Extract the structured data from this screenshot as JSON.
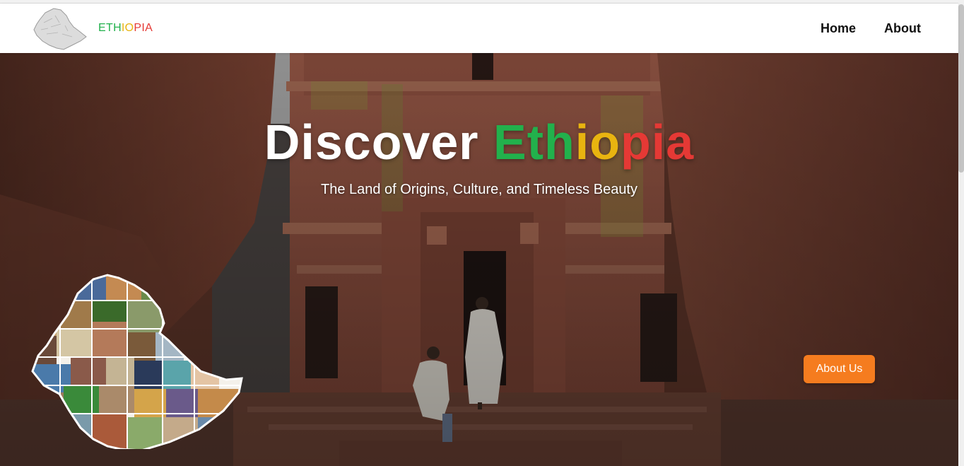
{
  "navbar": {
    "brand_letters": [
      {
        "ch": "E",
        "color": "#22b14c"
      },
      {
        "ch": "T",
        "color": "#22b14c"
      },
      {
        "ch": "H",
        "color": "#22b14c"
      },
      {
        "ch": "I",
        "color": "#e8b410"
      },
      {
        "ch": "O",
        "color": "#e8b410"
      },
      {
        "ch": "P",
        "color": "#e53935"
      },
      {
        "ch": "I",
        "color": "#e53935"
      },
      {
        "ch": "A",
        "color": "#e53935"
      }
    ],
    "links": {
      "home": "Home",
      "about": "About"
    }
  },
  "hero": {
    "title_word": "Discover",
    "title_letters": [
      {
        "ch": "E",
        "color": "#22b14c"
      },
      {
        "ch": "t",
        "color": "#22b14c"
      },
      {
        "ch": "h",
        "color": "#22b14c"
      },
      {
        "ch": "i",
        "color": "#e8b410"
      },
      {
        "ch": "o",
        "color": "#e8b410"
      },
      {
        "ch": "p",
        "color": "#e53935"
      },
      {
        "ch": "i",
        "color": "#e53935"
      },
      {
        "ch": "a",
        "color": "#e53935"
      }
    ],
    "subtitle": "The Land of Origins, Culture, and Timeless Beauty",
    "cta_label": "About Us"
  },
  "colors": {
    "accent": "#f57c1f",
    "green": "#22b14c",
    "yellow": "#e8b410",
    "red": "#e53935"
  },
  "icons": {
    "logo": "ethiopia-map-icon",
    "hero_collage": "ethiopia-collage-map"
  }
}
